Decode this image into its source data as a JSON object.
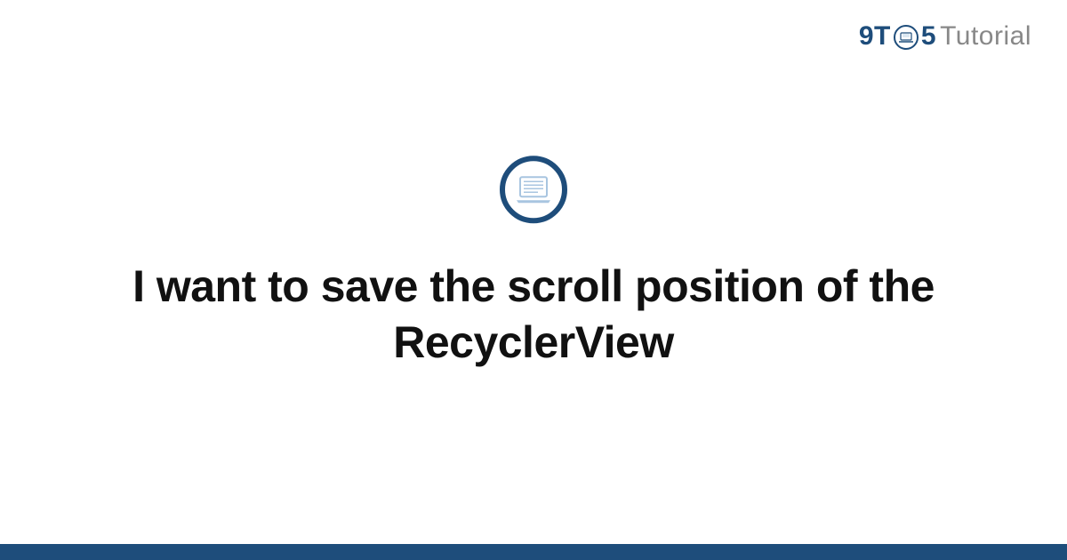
{
  "logo": {
    "part1": "9T",
    "part2": "5",
    "part3": "Tutorial",
    "circle_icon": "laptop-icon"
  },
  "center_icon": "laptop-icon",
  "title": "I want to save the scroll position of the RecyclerView",
  "colors": {
    "brand": "#1e4d7b",
    "muted": "#888888",
    "light_blue": "#a8c5e0"
  }
}
